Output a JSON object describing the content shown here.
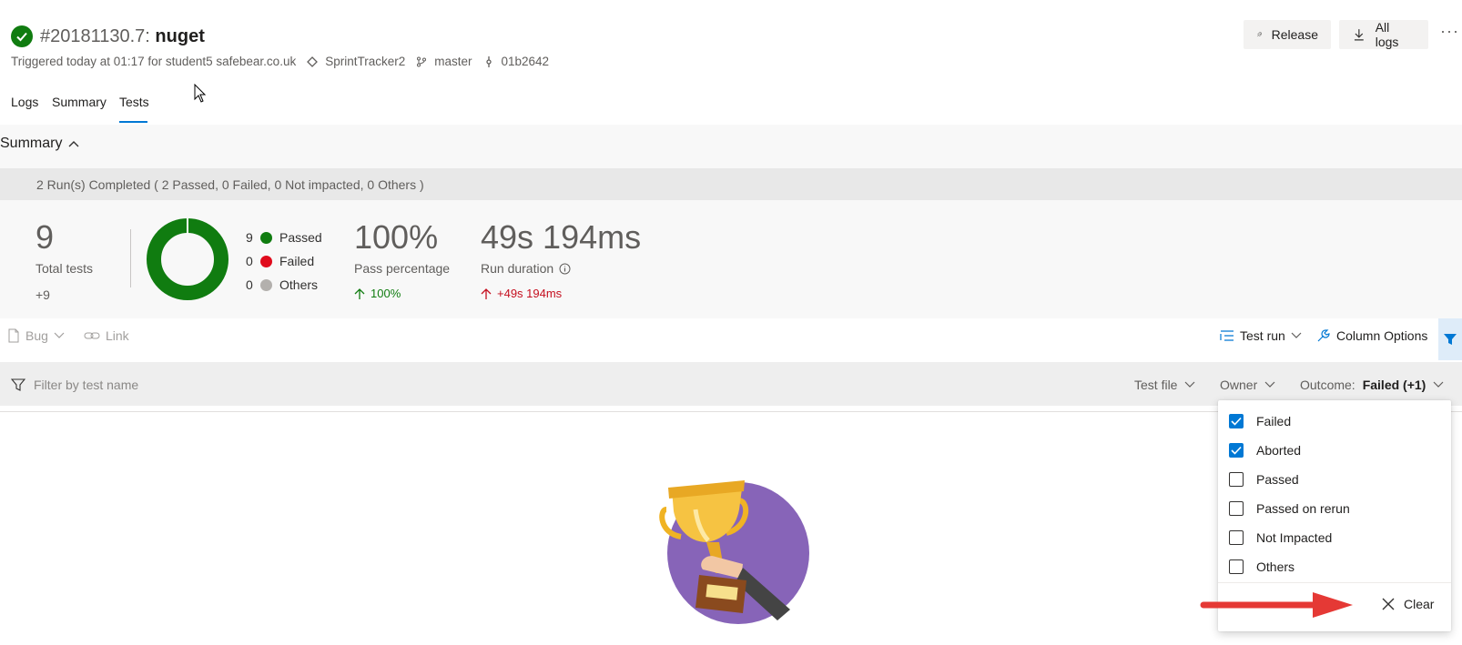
{
  "header": {
    "build_number": "#20181130.7:",
    "pipeline_name": "nuget",
    "triggered_text": "Triggered today at 01:17 for student5 safebear.co.uk",
    "repo": "SprintTracker2",
    "branch": "master",
    "commit": "01b2642",
    "release_label": "Release",
    "all_logs_label": "All logs",
    "more_label": "···"
  },
  "tabs": [
    {
      "label": "Logs"
    },
    {
      "label": "Summary"
    },
    {
      "label": "Tests",
      "active": true
    }
  ],
  "summary": {
    "heading": "Summary",
    "runs_text": "2 Run(s) Completed ( 2 Passed, 0 Failed, 0 Not impacted, 0 Others )",
    "total_tests": "9",
    "total_tests_label": "Total tests",
    "total_delta": "+9",
    "legend": [
      {
        "count": "9",
        "label": "Passed",
        "color": "#107c10"
      },
      {
        "count": "0",
        "label": "Failed",
        "color": "#e00b1c"
      },
      {
        "count": "0",
        "label": "Others",
        "color": "#b3b0ad"
      }
    ],
    "pass_percentage": "100%",
    "pass_percentage_label": "Pass percentage",
    "pass_delta": "100%",
    "run_duration": "49s 194ms",
    "run_duration_label": "Run duration",
    "duration_delta": "+49s 194ms"
  },
  "toolbar": {
    "bug_label": "Bug",
    "link_label": "Link",
    "test_run_label": "Test run",
    "column_options_label": "Column Options"
  },
  "filter_bar": {
    "placeholder": "Filter by test name",
    "test_file_label": "Test file",
    "owner_label": "Owner",
    "outcome_label": "Outcome:",
    "outcome_value": "Failed (+1)"
  },
  "outcome_options": [
    {
      "label": "Failed",
      "checked": true
    },
    {
      "label": "Aborted",
      "checked": true
    },
    {
      "label": "Passed",
      "checked": false
    },
    {
      "label": "Passed on rerun",
      "checked": false
    },
    {
      "label": "Not Impacted",
      "checked": false
    },
    {
      "label": "Others",
      "checked": false
    }
  ],
  "clear_label": "Clear",
  "colors": {
    "accent": "#0078d4",
    "success": "#107c10",
    "error": "#c50f1f",
    "annotation_arrow": "#e53935",
    "trophy_bg": "#8764b8"
  }
}
